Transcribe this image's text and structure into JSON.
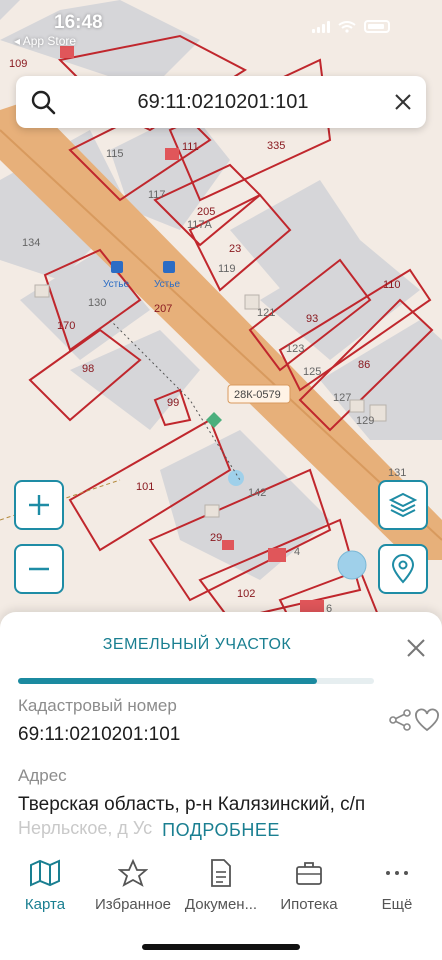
{
  "status_bar": {
    "time": "16:48",
    "back_app": "◂ App Store"
  },
  "search": {
    "value": "69:11:0210201:101"
  },
  "map": {
    "parcels": [
      "109",
      "115",
      "111",
      "335",
      "117",
      "205",
      "117А",
      "23",
      "119",
      "134",
      "207",
      "170",
      "130",
      "98",
      "121",
      "93",
      "110",
      "86",
      "123",
      "125",
      "127",
      "129",
      "131",
      "99",
      "101",
      "142",
      "29",
      "4",
      "102",
      "6"
    ],
    "stops": [
      "Устье",
      "Устье"
    ],
    "road_label": "28К-0579"
  },
  "sheet": {
    "title": "ЗЕМЕЛЬНЫЙ УЧАСТОК",
    "progress_fraction": 0.84,
    "cadastral_label": "Кадастровый номер",
    "cadastral_value": "69:11:0210201:101",
    "address_label": "Адрес",
    "address_line1": "Тверская область, р-н Калязинский, с/п",
    "address_line2": "Нерльское, д Ус",
    "more_label": "ПОДРОБНЕЕ"
  },
  "tabs": [
    {
      "label": "Карта",
      "icon": "map-icon",
      "active": true
    },
    {
      "label": "Избранное",
      "icon": "star-icon",
      "active": false
    },
    {
      "label": "Докумен...",
      "icon": "document-icon",
      "active": false
    },
    {
      "label": "Ипотека",
      "icon": "briefcase-icon",
      "active": false
    },
    {
      "label": "Ещё",
      "icon": "more-icon",
      "active": false
    }
  ],
  "colors": {
    "accent": "#1a7f91",
    "parcel_border": "#c0272d",
    "road": "#e7b07a"
  }
}
